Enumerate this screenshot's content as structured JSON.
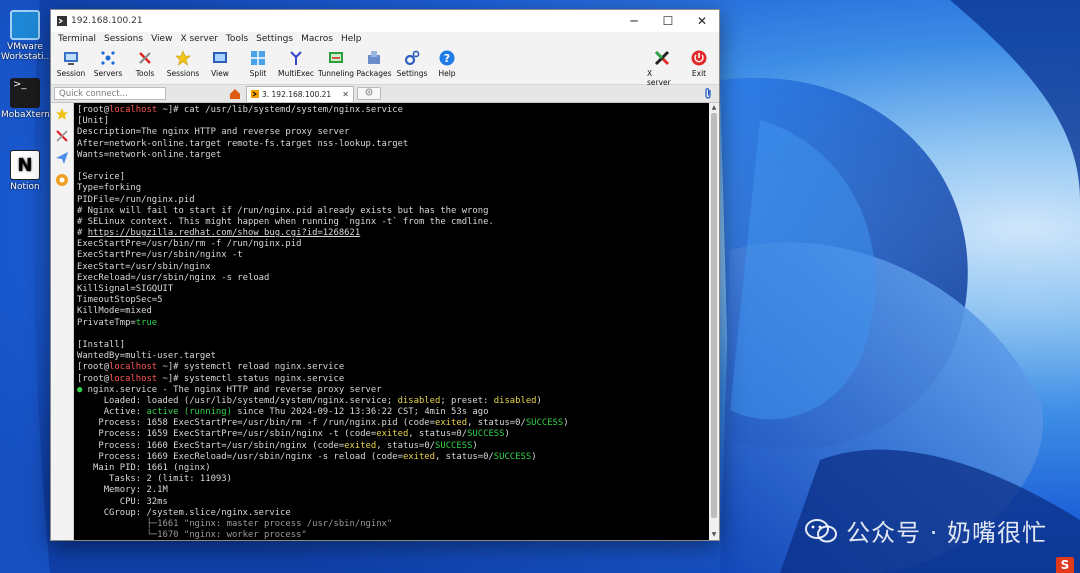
{
  "desktop": {
    "icons": [
      {
        "label_line1": "VMware",
        "label_line2": "Workstati..."
      },
      {
        "label_line1": "MobaXterm",
        "label_line2": ""
      },
      {
        "label_line1": "Notion",
        "label_line2": ""
      }
    ],
    "watermark": "公众号 · 奶嘴很忙",
    "tray_badge": "S"
  },
  "window": {
    "title": "192.168.100.21",
    "controls": {
      "minimize": "─",
      "maximize": "☐",
      "close": "✕"
    },
    "menu": [
      "Terminal",
      "Sessions",
      "View",
      "X server",
      "Tools",
      "Settings",
      "Macros",
      "Help"
    ],
    "toolbar": [
      {
        "label": "Session",
        "icon": "session-icon"
      },
      {
        "label": "Servers",
        "icon": "servers-icon"
      },
      {
        "label": "Tools",
        "icon": "tools-icon"
      },
      {
        "label": "Sessions",
        "icon": "sessions-star-icon"
      },
      {
        "label": "View",
        "icon": "view-icon"
      },
      {
        "label": "Split",
        "icon": "split-icon"
      },
      {
        "label": "MultiExec",
        "icon": "multiexec-icon"
      },
      {
        "label": "Tunneling",
        "icon": "tunneling-icon"
      },
      {
        "label": "Packages",
        "icon": "packages-icon"
      },
      {
        "label": "Settings",
        "icon": "settings-icon"
      },
      {
        "label": "Help",
        "icon": "help-icon"
      }
    ],
    "toolbar_right": [
      {
        "label": "X server",
        "icon": "xserver-icon"
      },
      {
        "label": "Exit",
        "icon": "exit-icon"
      }
    ],
    "quick_connect_placeholder": "Quick connect...",
    "session_tab": "3. 192.168.100.21",
    "session_tab_close": "✕"
  },
  "terminal": {
    "prompt_user": "[root@",
    "prompt_host": "localhost",
    "prompt_tail": " ~]# ",
    "lines": [
      {
        "segs": [
          {
            "t": "[root@"
          },
          {
            "t": "localhost",
            "c": "host"
          },
          {
            "t": " ~]# cat /usr/lib/systemd/system/nginx.service"
          }
        ]
      },
      {
        "segs": [
          {
            "t": "[Unit]"
          }
        ]
      },
      {
        "segs": [
          {
            "t": "Description=The nginx HTTP and reverse proxy server"
          }
        ]
      },
      {
        "segs": [
          {
            "t": "After=network-online.target remote-fs.target nss-lookup.target"
          }
        ]
      },
      {
        "segs": [
          {
            "t": "Wants=network-online.target"
          }
        ]
      },
      {
        "segs": [
          {
            "t": ""
          }
        ]
      },
      {
        "segs": [
          {
            "t": "[Service]"
          }
        ]
      },
      {
        "segs": [
          {
            "t": "Type=forking"
          }
        ]
      },
      {
        "segs": [
          {
            "t": "PIDFile=/run/nginx.pid"
          }
        ]
      },
      {
        "segs": [
          {
            "t": "# Nginx will fail to start if /run/nginx.pid already exists but has the wrong"
          }
        ]
      },
      {
        "segs": [
          {
            "t": "# SELinux context. This might happen when running `nginx -t` from the cmdline."
          }
        ]
      },
      {
        "segs": [
          {
            "t": "# "
          },
          {
            "t": "https://bugzilla.redhat.com/show_bug.cgi?id=1268621",
            "c": "link"
          }
        ]
      },
      {
        "segs": [
          {
            "t": "ExecStartPre=/usr/bin/rm -f /run/nginx.pid"
          }
        ]
      },
      {
        "segs": [
          {
            "t": "ExecStartPre=/usr/sbin/nginx -t"
          }
        ]
      },
      {
        "segs": [
          {
            "t": "ExecStart=/usr/sbin/nginx"
          }
        ]
      },
      {
        "segs": [
          {
            "t": "ExecReload=/usr/sbin/nginx -s reload"
          }
        ]
      },
      {
        "segs": [
          {
            "t": "KillSignal=SIGQUIT"
          }
        ]
      },
      {
        "segs": [
          {
            "t": "TimeoutStopSec=5"
          }
        ]
      },
      {
        "segs": [
          {
            "t": "KillMode=mixed"
          }
        ]
      },
      {
        "segs": [
          {
            "t": "PrivateTmp="
          },
          {
            "t": "true",
            "c": "gr"
          }
        ]
      },
      {
        "segs": [
          {
            "t": ""
          }
        ]
      },
      {
        "segs": [
          {
            "t": "[Install]"
          }
        ]
      },
      {
        "segs": [
          {
            "t": "WantedBy=multi-user.target"
          }
        ]
      },
      {
        "segs": [
          {
            "t": "[root@"
          },
          {
            "t": "localhost",
            "c": "host"
          },
          {
            "t": " ~]# systemctl reload nginx.service"
          }
        ]
      },
      {
        "segs": [
          {
            "t": "[root@"
          },
          {
            "t": "localhost",
            "c": "host"
          },
          {
            "t": " ~]# systemctl status nginx.service"
          }
        ]
      },
      {
        "segs": [
          {
            "t": "●",
            "c": "gr"
          },
          {
            "t": " nginx.service - The nginx HTTP and reverse proxy server"
          }
        ]
      },
      {
        "segs": [
          {
            "t": "     Loaded: loaded (/usr/lib/systemd/system/nginx.service; "
          },
          {
            "t": "disabled",
            "c": "yel"
          },
          {
            "t": "; preset: "
          },
          {
            "t": "disabled",
            "c": "yel"
          },
          {
            "t": ")"
          }
        ]
      },
      {
        "segs": [
          {
            "t": "     Active: "
          },
          {
            "t": "active (running)",
            "c": "gr"
          },
          {
            "t": " since Thu 2024-09-12 13:36:22 CST; 4min 53s ago"
          }
        ]
      },
      {
        "segs": [
          {
            "t": "    Process: 1658 ExecStartPre=/usr/bin/rm -f /run/nginx.pid (code="
          },
          {
            "t": "exited",
            "c": "yel"
          },
          {
            "t": ", status=0/"
          },
          {
            "t": "SUCCESS",
            "c": "gr"
          },
          {
            "t": ")"
          }
        ]
      },
      {
        "segs": [
          {
            "t": "    Process: 1659 ExecStartPre=/usr/sbin/nginx -t (code="
          },
          {
            "t": "exited",
            "c": "yel"
          },
          {
            "t": ", status=0/"
          },
          {
            "t": "SUCCESS",
            "c": "gr"
          },
          {
            "t": ")"
          }
        ]
      },
      {
        "segs": [
          {
            "t": "    Process: 1660 ExecStart=/usr/sbin/nginx (code="
          },
          {
            "t": "exited",
            "c": "yel"
          },
          {
            "t": ", status=0/"
          },
          {
            "t": "SUCCESS",
            "c": "gr"
          },
          {
            "t": ")"
          }
        ]
      },
      {
        "segs": [
          {
            "t": "    Process: 1669 ExecReload=/usr/sbin/nginx -s reload (code="
          },
          {
            "t": "exited",
            "c": "yel"
          },
          {
            "t": ", status=0/"
          },
          {
            "t": "SUCCESS",
            "c": "gr"
          },
          {
            "t": ")"
          }
        ]
      },
      {
        "segs": [
          {
            "t": "   Main PID: 1661 (nginx)"
          }
        ]
      },
      {
        "segs": [
          {
            "t": "      Tasks: 2 (limit: 11093)"
          }
        ]
      },
      {
        "segs": [
          {
            "t": "     Memory: 2.1M"
          }
        ]
      },
      {
        "segs": [
          {
            "t": "        CPU: 32ms"
          }
        ]
      },
      {
        "segs": [
          {
            "t": "     CGroup: /system.slice/nginx.service"
          }
        ]
      },
      {
        "segs": [
          {
            "t": "             ├─1661 \"nginx: master process /usr/sbin/nginx\"",
            "c": "dim"
          }
        ]
      },
      {
        "segs": [
          {
            "t": "             └─1670 \"nginx: worker process\"",
            "c": "dim"
          }
        ]
      }
    ]
  },
  "colors": {
    "terminal_bg": "#000000",
    "terminal_fg": "#d8d8d8",
    "host": "#ff5555",
    "green": "#35d04a",
    "yellow": "#e8d44d"
  }
}
